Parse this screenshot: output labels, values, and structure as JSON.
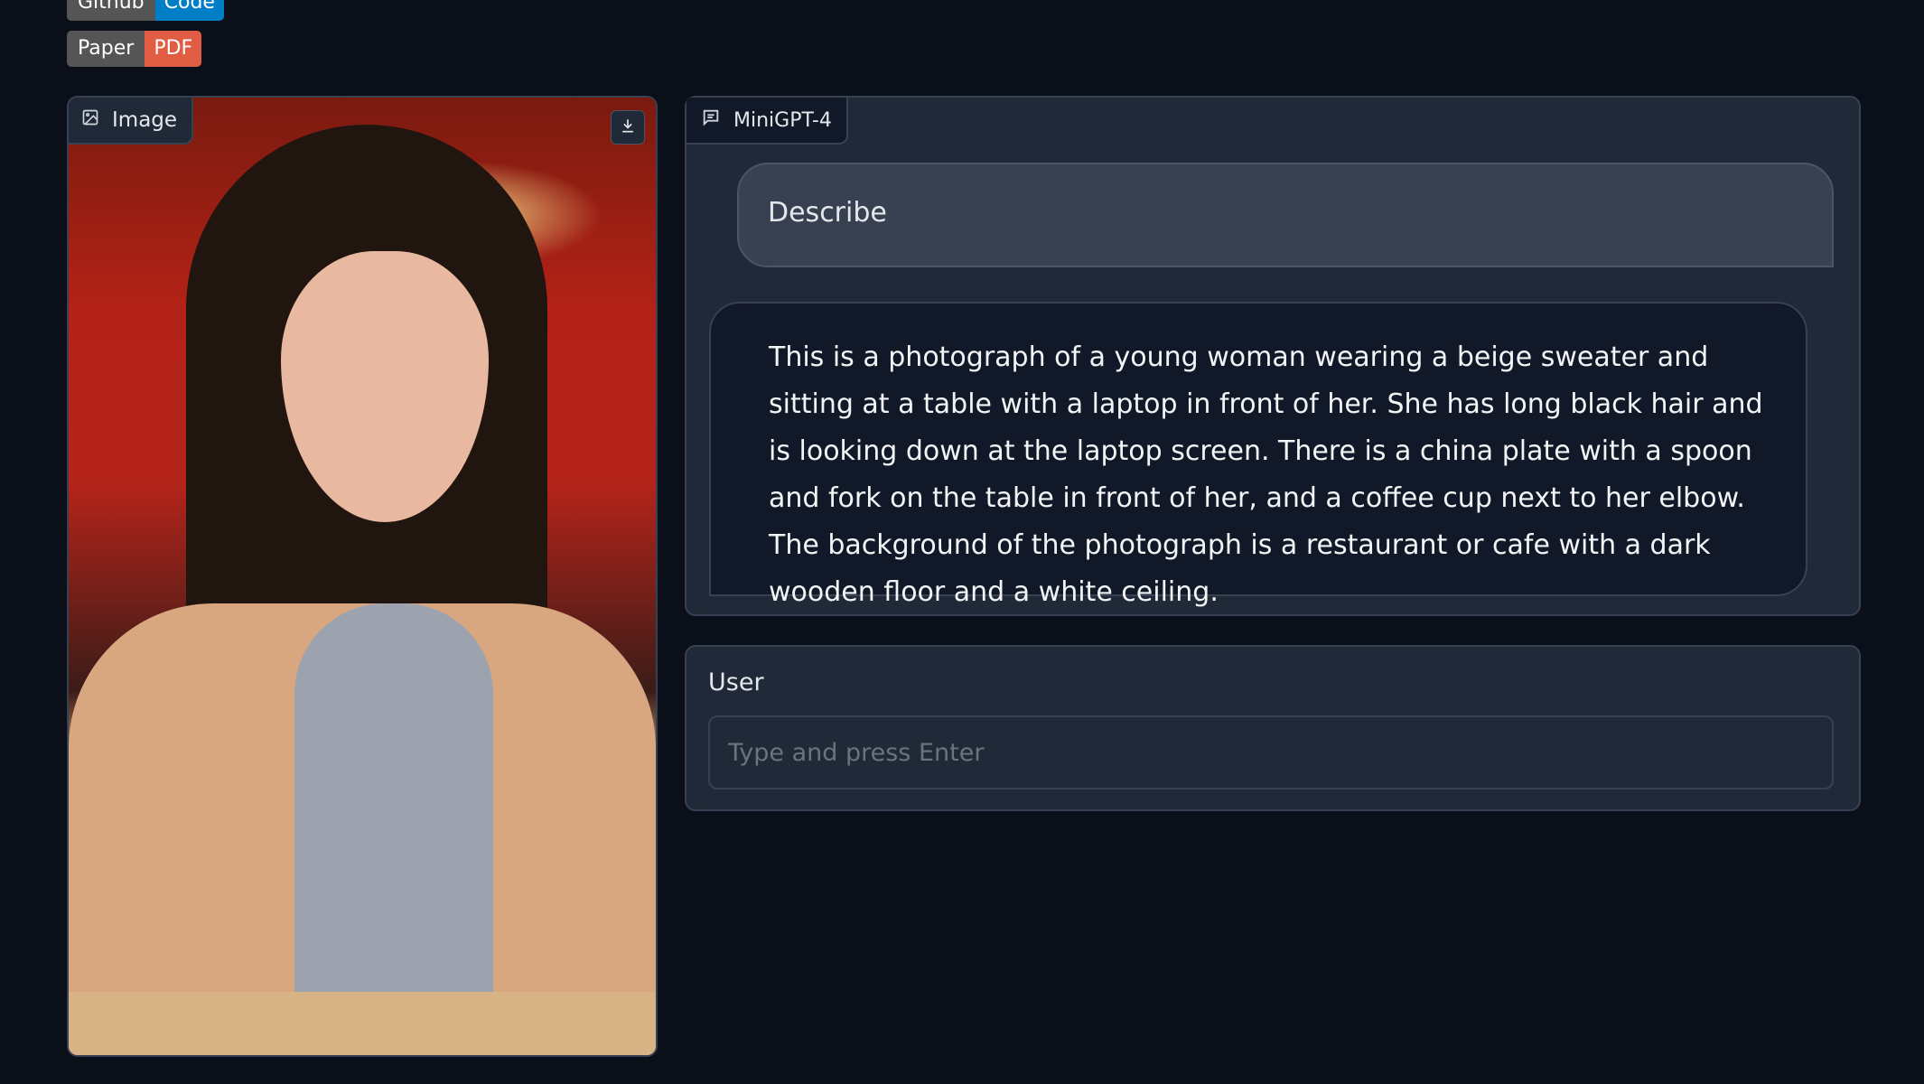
{
  "badges": {
    "github": {
      "left": "Github",
      "right": "Code",
      "right_color": "#007ec6"
    },
    "paper": {
      "left": "Paper",
      "right": "PDF",
      "right_color": "#e05d44"
    }
  },
  "image_panel": {
    "label": "Image",
    "label_icon": "image-icon",
    "download_icon": "download-icon"
  },
  "chat": {
    "label": "MiniGPT-4",
    "label_icon": "chat-icon",
    "messages": [
      {
        "role": "user",
        "text": "Describe"
      },
      {
        "role": "bot",
        "text": "This is a photograph of a young woman wearing a beige sweater and sitting at a table with a laptop in front of her. She has long black hair and is looking down at the laptop screen. There is a china plate with a spoon and fork on the table in front of her, and a coffee cup next to her elbow. The background of the photograph is a restaurant or cafe with a dark wooden floor and a white ceiling."
      }
    ]
  },
  "user_input": {
    "label": "User",
    "value": "",
    "placeholder": "Type and press Enter"
  },
  "colors": {
    "background": "#0b0f19",
    "panel": "#1f2937",
    "border": "#374151"
  }
}
